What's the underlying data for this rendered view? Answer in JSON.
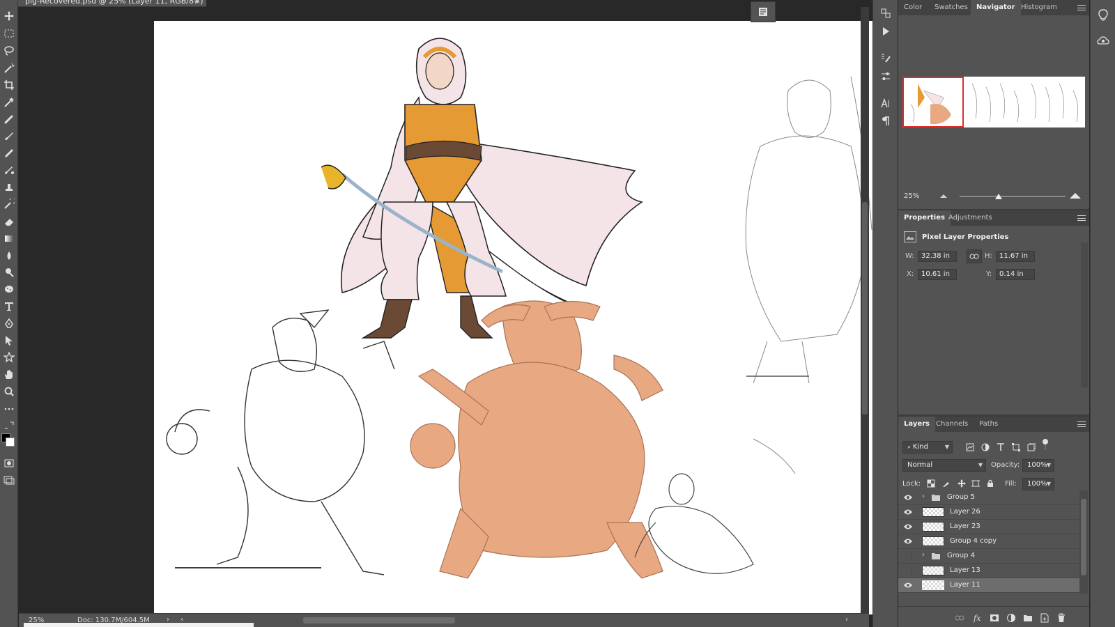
{
  "document": {
    "tab_title": "pig-Recovered.psd @ 25% (Layer 11, RGB/8#)",
    "close_glyph": "×"
  },
  "status_bar": {
    "zoom": "25%",
    "doc_info": "Doc: 130.7M/604.5M",
    "arrow": "›",
    "scroll_left": "‹",
    "scroll_right": "›"
  },
  "navigator_panel": {
    "tabs": [
      "Color",
      "Swatches",
      "Navigator",
      "Histogram"
    ],
    "active_tab": "Navigator",
    "zoom": "25%"
  },
  "properties_panel": {
    "tabs": [
      "Properties",
      "Adjustments"
    ],
    "active_tab": "Properties",
    "header": "Pixel Layer Properties",
    "w_label": "W:",
    "w_value": "32.38 in",
    "h_label": "H:",
    "h_value": "11.67 in",
    "x_label": "X:",
    "x_value": "10.61 in",
    "y_label": "Y:",
    "y_value": "0.14 in"
  },
  "layers_panel": {
    "tabs": [
      "Layers",
      "Channels",
      "Paths"
    ],
    "active_tab": "Layers",
    "filter_kind": "Kind",
    "blend_mode": "Normal",
    "opacity_label": "Opacity:",
    "opacity_value": "100%",
    "lock_label": "Lock:",
    "fill_label": "Fill:",
    "fill_value": "100%",
    "layers": [
      {
        "name": "Group 5",
        "type": "group",
        "visible": true,
        "selected": false
      },
      {
        "name": "Layer 26",
        "type": "pixel",
        "visible": true,
        "selected": false
      },
      {
        "name": "Layer 23",
        "type": "pixel",
        "visible": true,
        "selected": false
      },
      {
        "name": "Group 4 copy",
        "type": "pixel",
        "visible": true,
        "selected": false
      },
      {
        "name": "Group 4",
        "type": "group",
        "visible": false,
        "selected": false
      },
      {
        "name": "Layer 13",
        "type": "pixel",
        "visible": false,
        "selected": false
      },
      {
        "name": "Layer 11",
        "type": "pixel",
        "visible": true,
        "selected": true
      }
    ]
  },
  "colors": {
    "ui_dark": "#282828",
    "ui_panel": "#535353",
    "accent_red": "#e02b2b",
    "artwork_fill": "#e8a882",
    "tunic_orange": "#e59a33",
    "cloak_pink": "#f5e4e7"
  }
}
